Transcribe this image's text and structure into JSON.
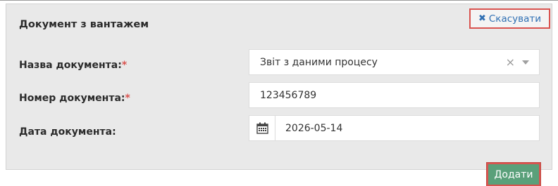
{
  "panel": {
    "title": "Документ з вантажем",
    "cancel_label": "Скасувати",
    "cancel_icon": "x-icon"
  },
  "form": {
    "doc_name": {
      "label": "Назва документа:",
      "required": "*",
      "value": "Звіт з даними процесу"
    },
    "doc_number": {
      "label": "Номер документа:",
      "required": "*",
      "value": "123456789"
    },
    "doc_date": {
      "label": "Дата документа:",
      "value": "2026-05-14"
    }
  },
  "actions": {
    "add_label": "Додати"
  },
  "colors": {
    "accent_red": "#d9534f",
    "link_blue": "#2f6fb3",
    "add_green": "#5aa07a"
  }
}
